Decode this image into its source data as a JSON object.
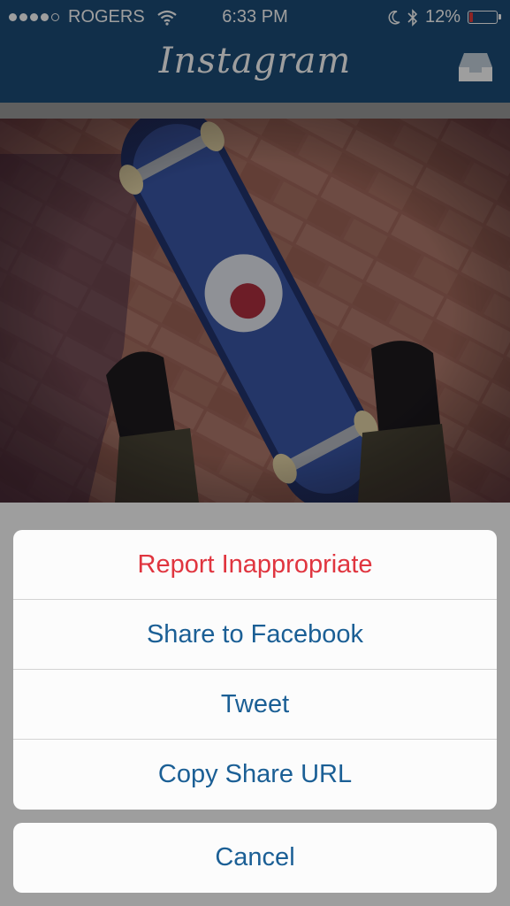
{
  "status_bar": {
    "carrier": "ROGERS",
    "time": "6:33 PM",
    "battery_percent": "12%",
    "battery_level": 0.12,
    "signal_bars_filled": 4,
    "signal_bars_total": 5,
    "icons": [
      "wifi-icon",
      "moon-icon",
      "bluetooth-icon",
      "battery-icon"
    ]
  },
  "nav": {
    "title": "Instagram",
    "inbox_icon": "inbox-icon"
  },
  "colors": {
    "nav_background": "#1c4d78",
    "action_text": "#1b5f95",
    "destructive_text": "#e0353f",
    "battery_low": "#e53a3a"
  },
  "action_sheet": {
    "actions": [
      {
        "label": "Report Inappropriate",
        "style": "destructive"
      },
      {
        "label": "Share to Facebook",
        "style": "default"
      },
      {
        "label": "Tweet",
        "style": "default"
      },
      {
        "label": "Copy Share URL",
        "style": "default"
      }
    ],
    "cancel_label": "Cancel"
  }
}
